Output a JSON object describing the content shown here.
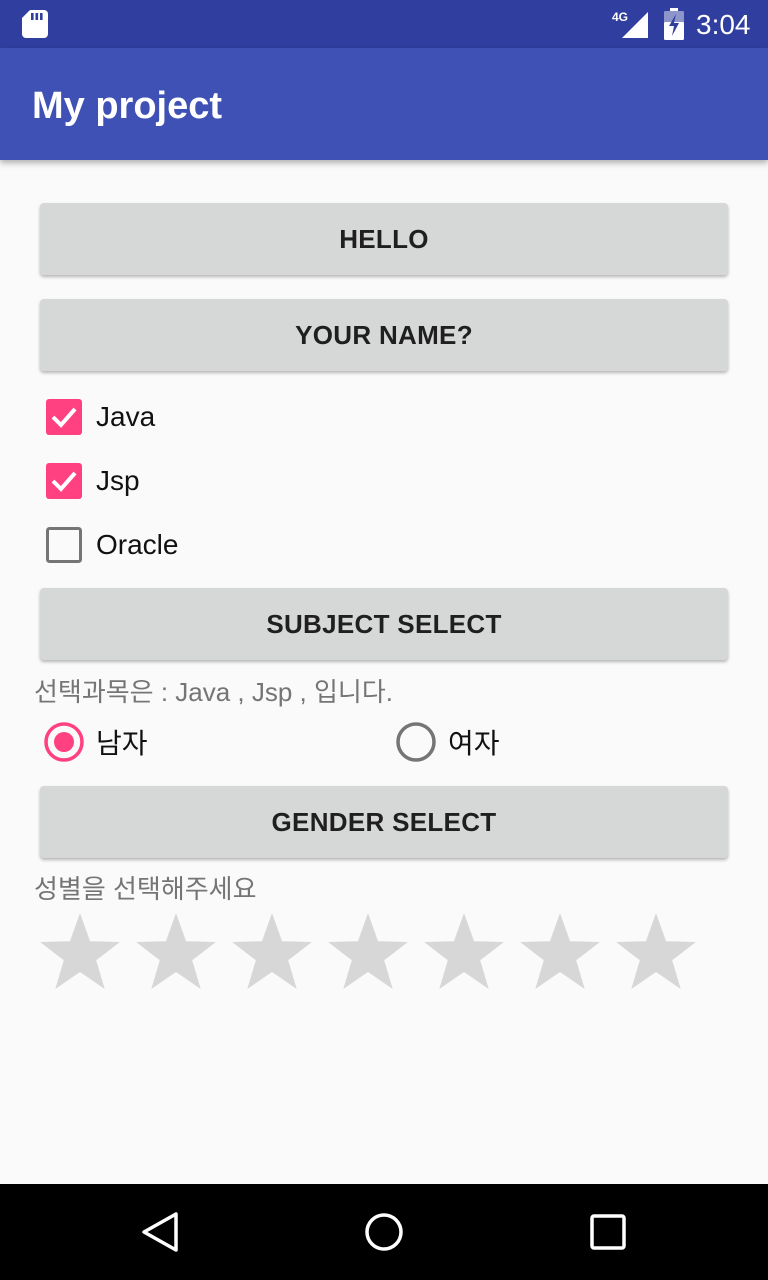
{
  "status_bar": {
    "network": "4G",
    "time": "3:04",
    "icons": [
      "sd-card-icon",
      "signal-icon",
      "battery-charging-icon"
    ]
  },
  "app_bar": {
    "title": "My project"
  },
  "buttons": {
    "hello": "HELLO",
    "your_name": "YOUR NAME?",
    "subject_select": "SUBJECT SELECT",
    "gender_select": "GENDER SELECT"
  },
  "checkboxes": [
    {
      "label": "Java",
      "checked": true
    },
    {
      "label": "Jsp",
      "checked": true
    },
    {
      "label": "Oracle",
      "checked": false
    }
  ],
  "subject_result": "선택과목은 :  Java , Jsp , 입니다.",
  "radios": [
    {
      "label": "남자",
      "selected": true
    },
    {
      "label": "여자",
      "selected": false
    }
  ],
  "gender_result": "성별을 선택해주세요",
  "rating": {
    "num_stars": 7,
    "value": 0
  },
  "colors": {
    "status_bar": "#303f9f",
    "app_bar": "#3f51b5",
    "accent": "#ff4081",
    "button": "#d6d7d7",
    "star_empty": "#d7d7d7"
  },
  "nav_bar": {
    "icons": [
      "back-icon",
      "home-icon",
      "recent-apps-icon"
    ]
  }
}
